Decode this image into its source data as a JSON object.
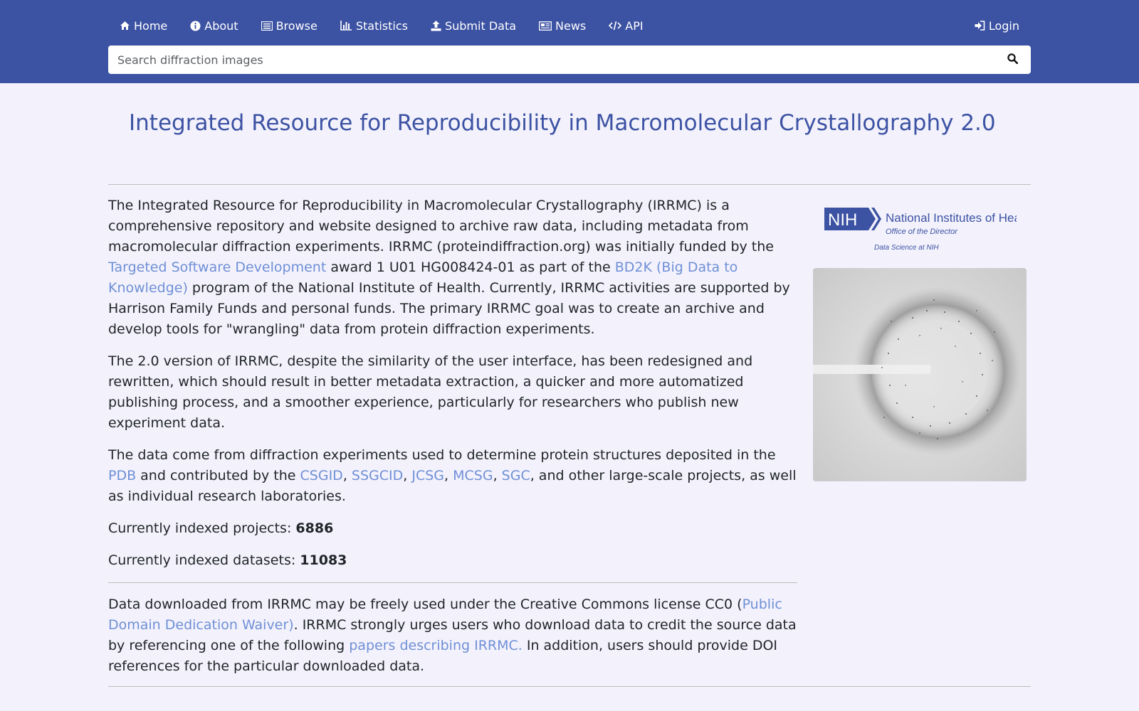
{
  "nav": {
    "items": [
      {
        "label": "Home",
        "icon": "home-icon"
      },
      {
        "label": "About",
        "icon": "info-icon"
      },
      {
        "label": "Browse",
        "icon": "list-icon"
      },
      {
        "label": "Statistics",
        "icon": "bar-chart-icon"
      },
      {
        "label": "Submit Data",
        "icon": "upload-icon"
      },
      {
        "label": "News",
        "icon": "newspaper-icon"
      },
      {
        "label": "API",
        "icon": "code-icon"
      }
    ],
    "login": {
      "label": "Login",
      "icon": "sign-in-icon"
    }
  },
  "search": {
    "placeholder": "Search diffraction images",
    "value": "",
    "icon": "search-icon"
  },
  "page": {
    "title": "Integrated Resource for Reproducibility in Macromolecular Crystallography 2.0"
  },
  "intro": {
    "p1_a": "The Integrated Resource for Reproducibility in Macromolecular Crystallography (IRRMC) is a comprehensive repository and website designed to archive raw data, including metadata from macromolecular diffraction experiments. IRRMC (proteindiffraction.org) was initially funded by the ",
    "p1_link1": "Targeted Software Development",
    "p1_b": " award 1 U01 HG008424-01 as part of the ",
    "p1_link2": "BD2K (Big Data to Knowledge)",
    "p1_c": " program of the National Institute of Health. Currently, IRRMC activities are supported by Harrison Family Funds and personal funds. The primary IRRMC goal was to create an archive and develop tools for \"wrangling\" data from protein diffraction experiments.",
    "p2": "The 2.0 version of IRRMC, despite the similarity of the user interface, has been redesigned and rewritten, which should result in better metadata extraction, a quicker and more automatized publishing process, and a smoother experience, particularly for researchers who publish new experiment data.",
    "p3_a": "The data come from diffraction experiments used to determine protein structures deposited in the ",
    "p3_pdb": "PDB",
    "p3_b": " and contributed by the ",
    "p3_csgid": "CSGID",
    "p3_ssgcid": "SSGCID",
    "p3_jcsg": "JCSG",
    "p3_mcsg": "MCSG",
    "p3_sgc": "SGC",
    "p3_c": ", and other large-scale projects, as well as individual research laboratories."
  },
  "stats": {
    "projects_label": "Currently indexed projects: ",
    "projects_value": "6886",
    "datasets_label": "Currently indexed datasets: ",
    "datasets_value": "11083"
  },
  "license": {
    "a": "Data downloaded from IRRMC may be freely used under the Creative Commons license CC0 (",
    "link1": "Public Domain Dedication Waiver)",
    "b": ". IRRMC strongly urges users who download data to credit the source data by referencing one of the following ",
    "link2": "papers describing IRRMC.",
    "c": " In addition, users should provide DOI references for the particular downloaded data."
  },
  "sidebar": {
    "logo_mark": "NIH",
    "logo_name": "National Institutes of Health",
    "logo_office": "Office of the Director",
    "logo_sub": "Data Science at NIH"
  },
  "colors": {
    "header_bg": "#3c52a3",
    "page_bg": "#f3f2fc",
    "link": "#6f8fd6",
    "title": "#3c52a3"
  }
}
